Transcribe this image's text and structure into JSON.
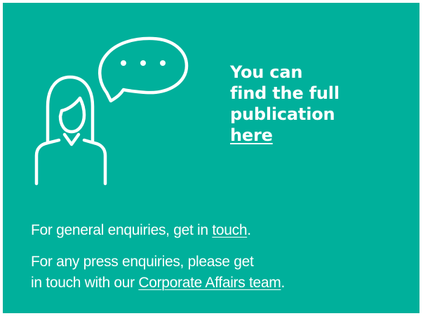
{
  "colors": {
    "card_background": "#00b09b",
    "foreground": "#ffffff"
  },
  "illustration": {
    "icon": "person-speech-bubble-icon"
  },
  "headline": {
    "line1": "You can",
    "line2": "find the full",
    "line3": "publication",
    "link_label": "here"
  },
  "general": {
    "prefix": "For general enquiries, get in ",
    "link_label": "touch",
    "suffix": "."
  },
  "press": {
    "line1": "For any press enquiries, please get",
    "line2_prefix": "in touch with our ",
    "link_label": "Corporate Affairs team",
    "suffix": "."
  }
}
